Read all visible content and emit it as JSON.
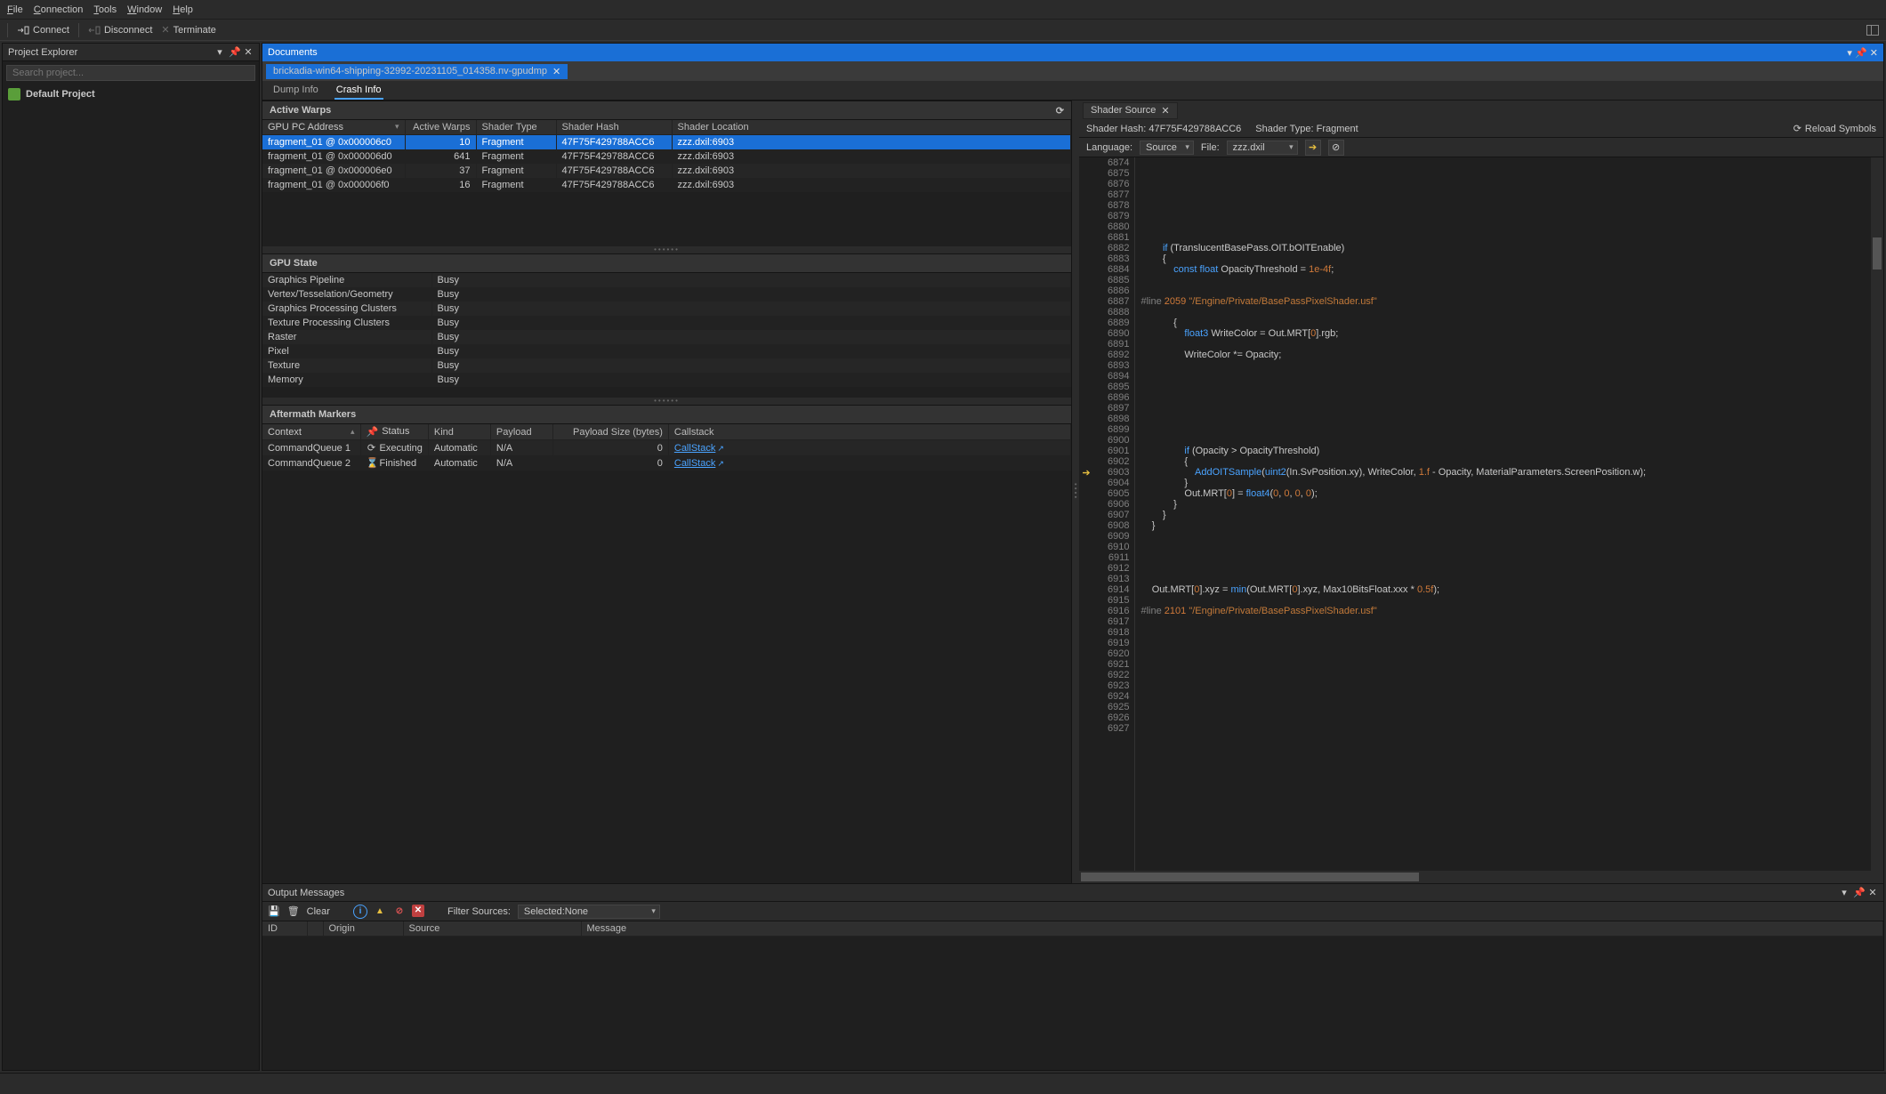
{
  "menu": {
    "file": "File",
    "connection": "Connection",
    "tools": "Tools",
    "window": "Window",
    "help": "Help"
  },
  "toolbar": {
    "connect": "Connect",
    "disconnect": "Disconnect",
    "terminate": "Terminate"
  },
  "projectExplorer": {
    "title": "Project Explorer",
    "searchPlaceholder": "Search project...",
    "root": "Default Project"
  },
  "documents": {
    "title": "Documents",
    "tab": "brickadia-win64-shipping-32992-20231105_014358.nv-gpudmp",
    "subtabs": {
      "dump": "Dump Info",
      "crash": "Crash Info"
    }
  },
  "activeWarps": {
    "title": "Active Warps",
    "cols": {
      "pc": "GPU PC Address",
      "warps": "Active Warps",
      "stype": "Shader Type",
      "hash": "Shader Hash",
      "loc": "Shader Location"
    },
    "rows": [
      {
        "pc": "fragment_01 @ 0x000006c0",
        "warps": 10,
        "stype": "Fragment",
        "hash": "47F75F429788ACC6",
        "loc": "zzz.dxil:6903",
        "sel": true
      },
      {
        "pc": "fragment_01 @ 0x000006d0",
        "warps": 641,
        "stype": "Fragment",
        "hash": "47F75F429788ACC6",
        "loc": "zzz.dxil:6903"
      },
      {
        "pc": "fragment_01 @ 0x000006e0",
        "warps": 37,
        "stype": "Fragment",
        "hash": "47F75F429788ACC6",
        "loc": "zzz.dxil:6903"
      },
      {
        "pc": "fragment_01 @ 0x000006f0",
        "warps": 16,
        "stype": "Fragment",
        "hash": "47F75F429788ACC6",
        "loc": "zzz.dxil:6903"
      }
    ]
  },
  "gpuState": {
    "title": "GPU State",
    "rows": [
      {
        "k": "Graphics Pipeline",
        "v": "Busy"
      },
      {
        "k": "Vertex/Tesselation/Geometry",
        "v": "Busy"
      },
      {
        "k": "Graphics Processing Clusters",
        "v": "Busy"
      },
      {
        "k": "Texture Processing Clusters",
        "v": "Busy"
      },
      {
        "k": "Raster",
        "v": "Busy"
      },
      {
        "k": "Pixel",
        "v": "Busy"
      },
      {
        "k": "Texture",
        "v": "Busy"
      },
      {
        "k": "Memory",
        "v": "Busy"
      }
    ]
  },
  "markers": {
    "title": "Aftermath Markers",
    "cols": {
      "ctx": "Context",
      "status": "Status",
      "kind": "Kind",
      "payload": "Payload",
      "psize": "Payload Size (bytes)",
      "callstack": "Callstack"
    },
    "rows": [
      {
        "ctx": "CommandQueue 1",
        "statusIcon": "⟳",
        "status": "Executing",
        "kind": "Automatic",
        "payload": "N/A",
        "psize": 0,
        "callstack": "CallStack"
      },
      {
        "ctx": "CommandQueue 2",
        "statusIcon": "⌛",
        "status": "Finished",
        "kind": "Automatic",
        "payload": "N/A",
        "psize": 0,
        "callstack": "CallStack"
      }
    ]
  },
  "shader": {
    "tab": "Shader Source",
    "hashLabel": "Shader Hash:",
    "hash": "47F75F429788ACC6",
    "typeLabel": "Shader Type:",
    "type": "Fragment",
    "reload": "Reload Symbols",
    "langLabel": "Language:",
    "lang": "Source",
    "fileLabel": "File:",
    "file": "zzz.dxil",
    "arrowLine": 6903,
    "startLine": 6874,
    "endLine": 6927
  },
  "output": {
    "title": "Output Messages",
    "clear": "Clear",
    "filterLabel": "Filter Sources:",
    "filterValue": "Selected:None",
    "cols": {
      "id": "ID",
      "origin": "Origin",
      "source": "Source",
      "message": "Message"
    }
  }
}
